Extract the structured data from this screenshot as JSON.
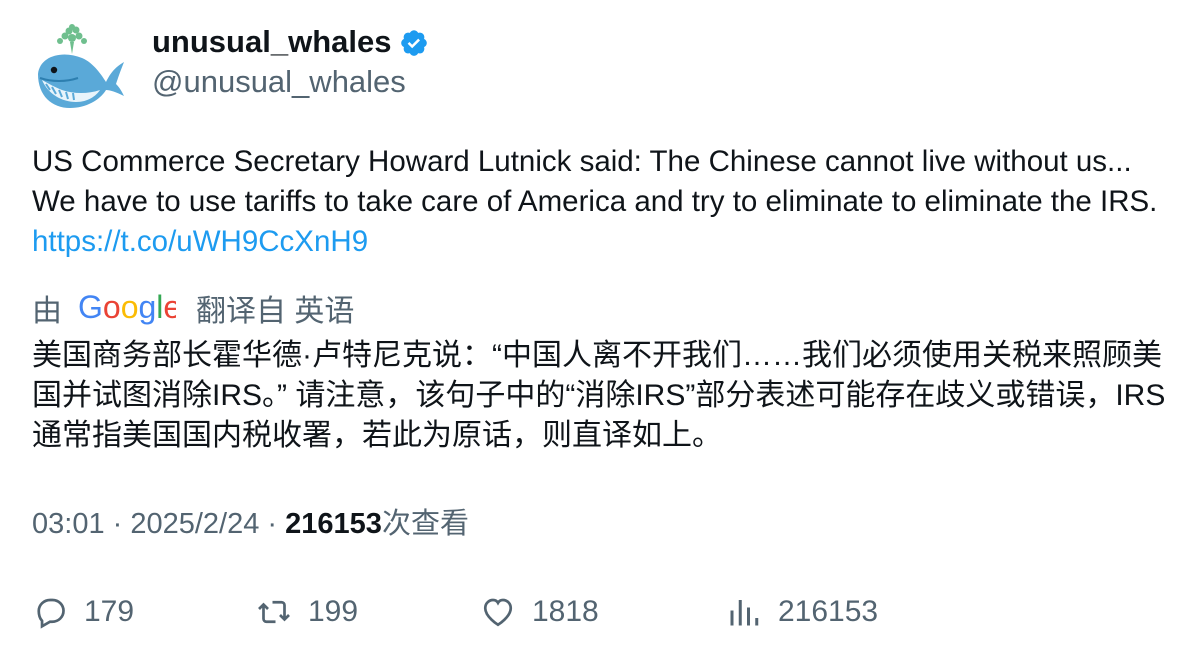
{
  "author": {
    "display_name": "unusual_whales",
    "handle": "@unusual_whales",
    "verified_icon": "verified-badge-icon",
    "verified_color": "#1d9bf0",
    "avatar_icon": "whale-avatar-icon"
  },
  "tweet": {
    "text": "US Commerce Secretary Howard Lutnick said: The Chinese cannot live without us... We have to use tariffs to take care of America and try to eliminate to eliminate the IRS. ",
    "link": "https://t.co/uWH9CcXnH9",
    "link_color": "#1d9bf0"
  },
  "translation": {
    "by_label": "由",
    "logo_text": "Google",
    "from_label": "翻译自 英语",
    "text": "美国商务部长霍华德·卢特尼克说：“中国人离不开我们……我们必须使用关税来照顾美国并试图消除IRS。” 请注意，该句子中的“消除IRS”部分表述可能存在歧义或错误，IRS通常指美国国内税收署，若此为原话，则直译如上。"
  },
  "meta": {
    "time": "03:01",
    "separator": " · ",
    "date": "2025/2/24",
    "views_count": "216153",
    "views_label": "次查看"
  },
  "actions": {
    "reply_count": "179",
    "retweet_count": "199",
    "like_count": "1818",
    "views_count": "216153"
  }
}
